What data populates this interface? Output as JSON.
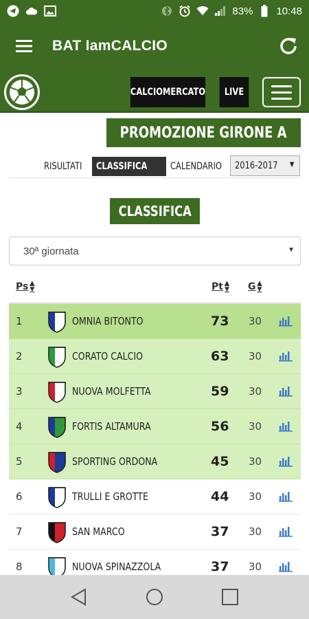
{
  "status_bar": {
    "left_icons": [
      "telegram-icon",
      "cloud-icon",
      "image-icon"
    ],
    "right_icons": [
      "bluetooth-icon",
      "alarm-icon",
      "wifi-icon",
      "signal-icon"
    ],
    "battery": "83%",
    "time": "10:48"
  },
  "app_bar": {
    "title": "BAT IamCALCIO",
    "menu_icon": "hamburger-icon",
    "refresh_icon": "refresh-icon"
  },
  "site_header": {
    "logo_icon": "soccer-ball-icon",
    "calciomercato_label": "CALCIOMERCATO",
    "live_label": "LIVE",
    "menu_icon": "hamburger-icon"
  },
  "championship": {
    "title": "PROMOZIONE GIRONE A"
  },
  "tabs": {
    "results": "RISULTATI",
    "standings": "CLASSIFICA",
    "calendar": "CALENDARIO",
    "season": "2016-2017"
  },
  "standings": {
    "title": "CLASSIFICA",
    "round": "30ª giornata",
    "headers": {
      "position": "Ps",
      "points": "Pt",
      "games": "G"
    },
    "rows": [
      {
        "pos": "1",
        "team": "OMNIA BITONTO",
        "pts": "73",
        "games": "30",
        "crest": [
          "#1a3a9c",
          "#ffffff"
        ],
        "highlight": "top"
      },
      {
        "pos": "2",
        "team": "CORATO CALCIO",
        "pts": "63",
        "games": "30",
        "crest": [
          "#2f9a3a",
          "#ffffff"
        ],
        "highlight": "yes"
      },
      {
        "pos": "3",
        "team": "NUOVA MOLFETTA",
        "pts": "59",
        "games": "30",
        "crest": [
          "#d0202a",
          "#ffffff"
        ],
        "highlight": "yes"
      },
      {
        "pos": "4",
        "team": "FORTIS ALTAMURA",
        "pts": "56",
        "games": "30",
        "crest": [
          "#1a3a9c",
          "#2f9a3a"
        ],
        "highlight": "yes"
      },
      {
        "pos": "5",
        "team": "SPORTING ORDONA",
        "pts": "45",
        "games": "30",
        "crest": [
          "#d0202a",
          "#1a3a9c"
        ],
        "highlight": "yes"
      },
      {
        "pos": "6",
        "team": "TRULLI E GROTTE",
        "pts": "44",
        "games": "30",
        "crest": [
          "#1a3a9c",
          "#ffffff"
        ],
        "highlight": "no"
      },
      {
        "pos": "7",
        "team": "SAN MARCO",
        "pts": "37",
        "games": "30",
        "crest": [
          "#111111",
          "#d0202a"
        ],
        "highlight": "no"
      },
      {
        "pos": "8",
        "team": "NUOVA SPINAZZOLA",
        "pts": "37",
        "games": "30",
        "crest": [
          "#48b8e0",
          "#ffffff"
        ],
        "highlight": "no"
      }
    ],
    "stats_icon": "bar-chart-icon"
  },
  "nav_bar": {
    "back_icon": "back-triangle-icon",
    "home_icon": "home-circle-icon",
    "recents_icon": "recents-square-icon"
  },
  "colors": {
    "brand_green": "#3d6b22",
    "highlight_top": "#b8e08e",
    "highlight": "#d6f0bd",
    "stats_blue": "#3a7bc8"
  }
}
